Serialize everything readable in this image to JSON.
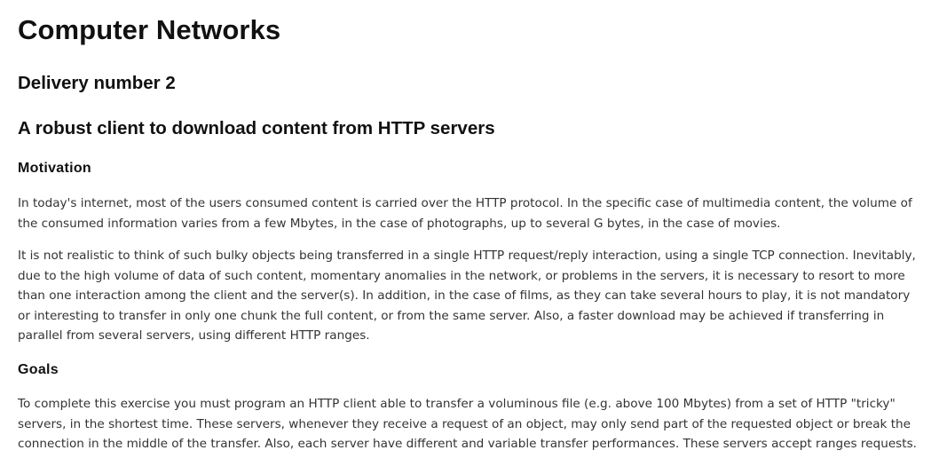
{
  "title": "Computer Networks",
  "subtitle": "Delivery number 2",
  "assignment_title": "A robust client to download content from HTTP servers",
  "sections": {
    "motivation": {
      "heading": "Motivation",
      "paragraphs": [
        "In today's internet, most of the users consumed content is carried over the HTTP protocol. In the specific case of multimedia content, the volume of the consumed information varies from a few Mbytes, in the case of photographs, up to several G bytes, in the case of movies.",
        "It is not realistic to think of such bulky objects being transferred in a single HTTP request/reply interaction, using a single TCP connection. Inevitably, due to the high volume of data of such content, momentary anomalies in the network, or problems in the servers, it is necessary to resort to more than one interaction among the client and the server(s). In addition, in the case of films, as they can take several hours to play, it is not mandatory or interesting to transfer in only one chunk the full content, or from the same server. Also, a faster download may be achieved if transferring in parallel from several servers, using different HTTP ranges."
      ]
    },
    "goals": {
      "heading": "Goals",
      "paragraphs": [
        "To complete this exercise you must program an HTTP client able to transfer a voluminous file (e.g. above 100 Mbytes) from a set of HTTP \"tricky\" servers, in the shortest time. These servers, whenever they receive a request of an object, may only send part of the requested object or break the connection in the middle of the transfer. Also, each server have different and variable transfer performances. These servers accept ranges requests."
      ]
    }
  }
}
